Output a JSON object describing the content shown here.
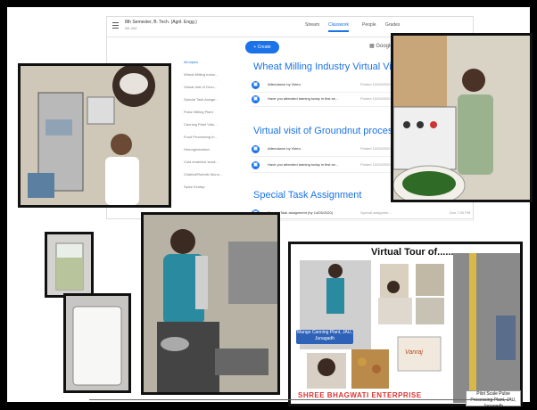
{
  "classroom": {
    "course_title": "8th Semester, B. Tech. (Agril. Engg.)",
    "course_sub": "AE-444",
    "tabs": [
      "Stream",
      "Classwork",
      "People",
      "Grades"
    ],
    "create_label": "Create",
    "calendar_label": "Google",
    "sidebar_items": [
      "All topics",
      "Wheat Milling Indus...",
      "Virtual visit of Grou...",
      "Special Task Assign...",
      "Pulse Milling Plant",
      "Canning Plant Virtu...",
      "Food Processing In...",
      "Homogenization",
      "Cold chain/Ice stora...",
      "Chatbot/Robotic Mono...",
      "Spice Ecotop"
    ],
    "topics": [
      {
        "heading": "Wheat Milling Industry Virtual Visit",
        "rows": [
          {
            "text": "Attendance by Video.",
            "date": "Posted 10/03/2020"
          },
          {
            "text": "Have you attended training today in first se...",
            "date": "Posted 10/03/2020"
          }
        ]
      },
      {
        "heading": "Virtual visit of Groundnut processi",
        "rows": [
          {
            "text": "Attendance by Video.",
            "date": "Posted 10/03/2020"
          },
          {
            "text": "Have you attended training today in first se...",
            "date": "Posted 10/03/2020"
          }
        ]
      },
      {
        "heading": "Special Task Assignment",
        "rows": [
          {
            "text": "Special Task assignment (by 14/05/2020)",
            "date": "Special assignme...",
            "due": "Due 7:00 PM"
          }
        ]
      }
    ]
  },
  "collage": {
    "title": "Virtual Tour of......",
    "caption_left": "Mango Canning Plant, JAU, Junagadh",
    "caption_right": "Pilot Scale Pulse Processing Plant, JAU, Junagadh",
    "brand": "SHREE BHAGWATI ENTERPRISE",
    "logo_text": "Vanraj"
  },
  "colors": {
    "accent": "#1a73e8",
    "caption_bg": "#2e62b8",
    "brand": "#d33333"
  }
}
